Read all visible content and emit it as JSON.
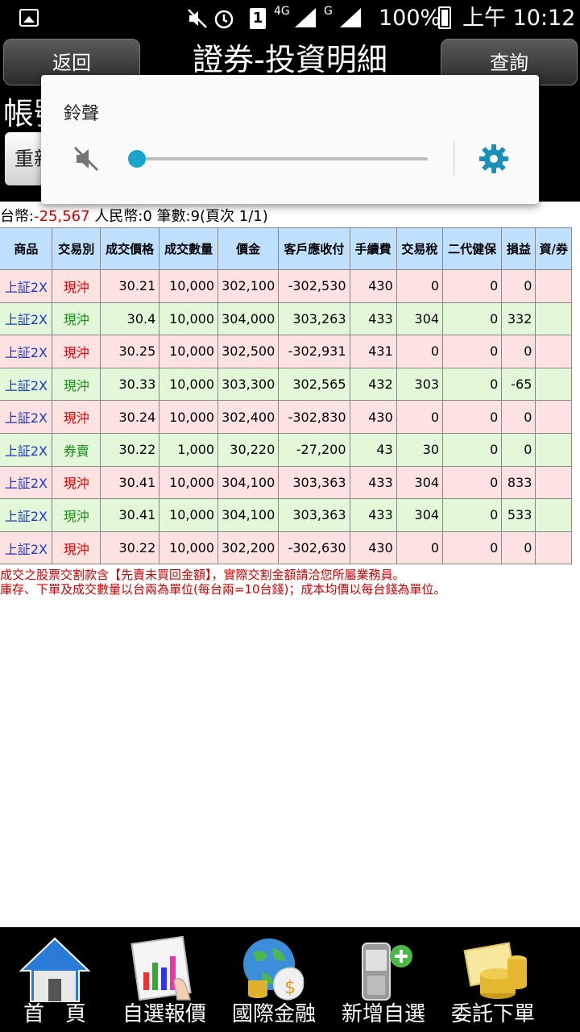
{
  "status_bar": {
    "network": "4G",
    "network_small": "G",
    "sim_slot": "1",
    "battery": "100%",
    "time": "上午 10:12"
  },
  "header": {
    "back_label": "返回",
    "title": "證券-投資明細",
    "query_label": "查詢"
  },
  "filter": {
    "account_label": "帳號",
    "reset_label": "重新"
  },
  "summary": {
    "prefix": "台幣:",
    "twd_value": "-25,567",
    "rest": " 人民幣:0 筆數:9(頁次 1/1)"
  },
  "table": {
    "headers": [
      "商品",
      "交易別",
      "成交價格",
      "成交數量",
      "價金",
      "客戶應收付",
      "手續費",
      "交易稅",
      "二代健保",
      "損益",
      "資/券"
    ],
    "rows": [
      {
        "product": "上証2X",
        "type": "現沖",
        "price": "30.21",
        "qty": "10,000",
        "amount": "302,100",
        "receivable": "-302,530",
        "fee": "430",
        "tax": "0",
        "nhi": "0",
        "pl": "0",
        "margin": ""
      },
      {
        "product": "上証2X",
        "type": "現沖",
        "price": "30.4",
        "qty": "10,000",
        "amount": "304,000",
        "receivable": "303,263",
        "fee": "433",
        "tax": "304",
        "nhi": "0",
        "pl": "332",
        "margin": ""
      },
      {
        "product": "上証2X",
        "type": "現沖",
        "price": "30.25",
        "qty": "10,000",
        "amount": "302,500",
        "receivable": "-302,931",
        "fee": "431",
        "tax": "0",
        "nhi": "0",
        "pl": "0",
        "margin": ""
      },
      {
        "product": "上証2X",
        "type": "現沖",
        "price": "30.33",
        "qty": "10,000",
        "amount": "303,300",
        "receivable": "302,565",
        "fee": "432",
        "tax": "303",
        "nhi": "0",
        "pl": "-65",
        "margin": ""
      },
      {
        "product": "上証2X",
        "type": "現沖",
        "price": "30.24",
        "qty": "10,000",
        "amount": "302,400",
        "receivable": "-302,830",
        "fee": "430",
        "tax": "0",
        "nhi": "0",
        "pl": "0",
        "margin": ""
      },
      {
        "product": "上証2X",
        "type": "券賣",
        "price": "30.22",
        "qty": "1,000",
        "amount": "30,220",
        "receivable": "-27,200",
        "fee": "43",
        "tax": "30",
        "nhi": "0",
        "pl": "0",
        "margin": ""
      },
      {
        "product": "上証2X",
        "type": "現沖",
        "price": "30.41",
        "qty": "10,000",
        "amount": "304,100",
        "receivable": "303,363",
        "fee": "433",
        "tax": "304",
        "nhi": "0",
        "pl": "833",
        "margin": ""
      },
      {
        "product": "上証2X",
        "type": "現沖",
        "price": "30.41",
        "qty": "10,000",
        "amount": "304,100",
        "receivable": "303,363",
        "fee": "433",
        "tax": "304",
        "nhi": "0",
        "pl": "533",
        "margin": ""
      },
      {
        "product": "上証2X",
        "type": "現沖",
        "price": "30.22",
        "qty": "10,000",
        "amount": "302,200",
        "receivable": "-302,630",
        "fee": "430",
        "tax": "0",
        "nhi": "0",
        "pl": "0",
        "margin": ""
      }
    ]
  },
  "notes": [
    "成交之股票交割款含【先賣未買回金額】，實際交割金額請洽您所屬業務員。",
    "庫存、下單及成交數量以台兩為單位(每台兩=10台錢)；成本均價以每台錢為單位。"
  ],
  "volume_popup": {
    "label": "鈴聲",
    "level": 0,
    "accent_color": "#1aa3cf"
  },
  "bottom_nav": [
    {
      "label": "首　頁",
      "icon": "home-icon"
    },
    {
      "label": "自選報價",
      "icon": "chart-quote-icon"
    },
    {
      "label": "國際金融",
      "icon": "globe-money-icon"
    },
    {
      "label": "新增自選",
      "icon": "add-phone-icon"
    },
    {
      "label": "委託下單",
      "icon": "coins-order-icon"
    }
  ]
}
